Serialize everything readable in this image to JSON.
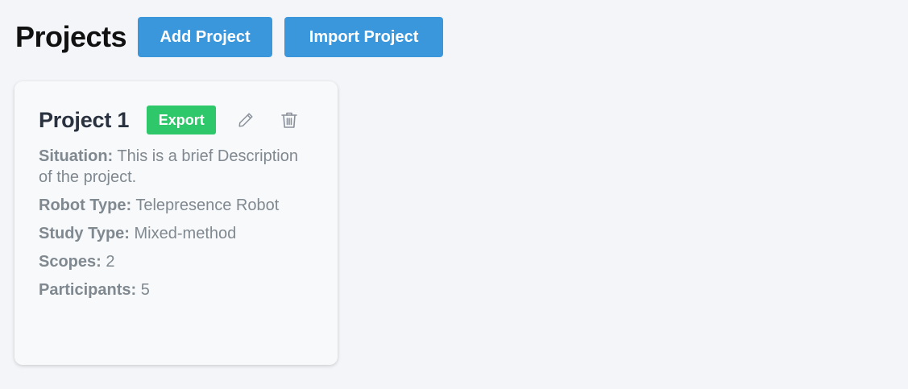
{
  "header": {
    "title": "Projects",
    "add_label": "Add Project",
    "import_label": "Import Project"
  },
  "colors": {
    "background": "#f3f5f8",
    "primary_button": "#3b97dc",
    "export_button": "#2ec86b",
    "card_title": "#2a3240",
    "detail_text": "#808890"
  },
  "project": {
    "name": "Project 1",
    "export_label": "Export",
    "edit_icon": "pencil-icon",
    "delete_icon": "trash-icon",
    "details": [
      {
        "label": "Situation:",
        "value": " This is a brief Description of the project."
      },
      {
        "label": "Robot Type:",
        "value": " Telepresence Robot"
      },
      {
        "label": "Study Type:",
        "value": " Mixed-method"
      },
      {
        "label": "Scopes:",
        "value": " 2"
      },
      {
        "label": "Participants:",
        "value": " 5"
      }
    ]
  }
}
